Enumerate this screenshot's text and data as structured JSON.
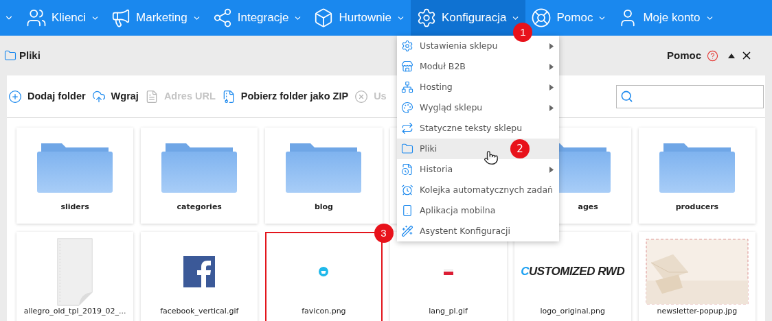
{
  "nav": {
    "lead_chevron": true,
    "items": [
      {
        "label": "Klienci",
        "selected": false
      },
      {
        "label": "Marketing",
        "selected": false
      },
      {
        "label": "Integracje",
        "selected": false
      },
      {
        "label": "Hurtownie",
        "selected": false
      },
      {
        "label": "Konfiguracja",
        "selected": true,
        "callout": "1"
      },
      {
        "label": "Pomoc",
        "selected": false
      },
      {
        "label": "Moje konto",
        "selected": false
      }
    ]
  },
  "page": {
    "title": "Pliki",
    "help": "Pomoc"
  },
  "toolbar": [
    {
      "label": "Dodaj folder",
      "disabled": false
    },
    {
      "label": "Wgraj",
      "disabled": false
    },
    {
      "label": "Adres URL",
      "disabled": true
    },
    {
      "label": "Pobierz folder jako ZIP",
      "disabled": false
    },
    {
      "label": "Us",
      "disabled": true
    }
  ],
  "items": [
    {
      "kind": "folder",
      "name": "sliders",
      "selected": false
    },
    {
      "kind": "folder",
      "name": "categories",
      "selected": false
    },
    {
      "kind": "folder",
      "name": "blog",
      "selected": false
    },
    {
      "kind": "hidden",
      "selected": false
    },
    {
      "kind": "folder",
      "name": "ages",
      "clipped": true,
      "selected": false
    },
    {
      "kind": "folder",
      "name": "producers",
      "selected": false
    },
    {
      "kind": "file",
      "preview": {
        "kind": "document"
      },
      "name": "allegro_old_tpl_2019_02_...",
      "selected": false
    },
    {
      "kind": "file",
      "preview": {
        "kind": "facebook"
      },
      "name": "facebook_vertical.gif",
      "selected": false
    },
    {
      "kind": "file",
      "preview": {
        "kind": "favicon"
      },
      "name": "favicon.png",
      "selected": true,
      "callout": "3"
    },
    {
      "kind": "file",
      "preview": {
        "kind": "flag"
      },
      "name": "lang_pl.gif",
      "selected": false
    },
    {
      "kind": "file",
      "preview": {
        "kind": "logo",
        "text": "CUSTOMIZED RWD"
      },
      "name": "logo_original.png",
      "selected": false
    },
    {
      "kind": "file",
      "name": "newsletter-popup.jpg",
      "selected": false
    }
  ],
  "menu": {
    "items": [
      {
        "label": "Ustawienia sklepu",
        "submenu": true,
        "selected": false
      },
      {
        "label": "Moduł B2B",
        "submenu": true,
        "selected": false
      },
      {
        "label": "Hosting",
        "submenu": true,
        "selected": false
      },
      {
        "label": "Wygląd sklepu",
        "submenu": true,
        "selected": false
      },
      {
        "label": "Statyczne teksty sklepu",
        "submenu": false,
        "selected": false
      },
      {
        "label": "Pliki",
        "submenu": false,
        "selected": true,
        "callout": "2"
      },
      {
        "label": "Historia",
        "submenu": true,
        "selected": false
      },
      {
        "label": "Kolejka automatycznych zadań",
        "submenu": false,
        "selected": false
      },
      {
        "label": "Aplikacja mobilna",
        "submenu": false,
        "selected": false
      },
      {
        "label": "Asystent Konfiguracji",
        "submenu": false,
        "selected": false
      }
    ]
  }
}
